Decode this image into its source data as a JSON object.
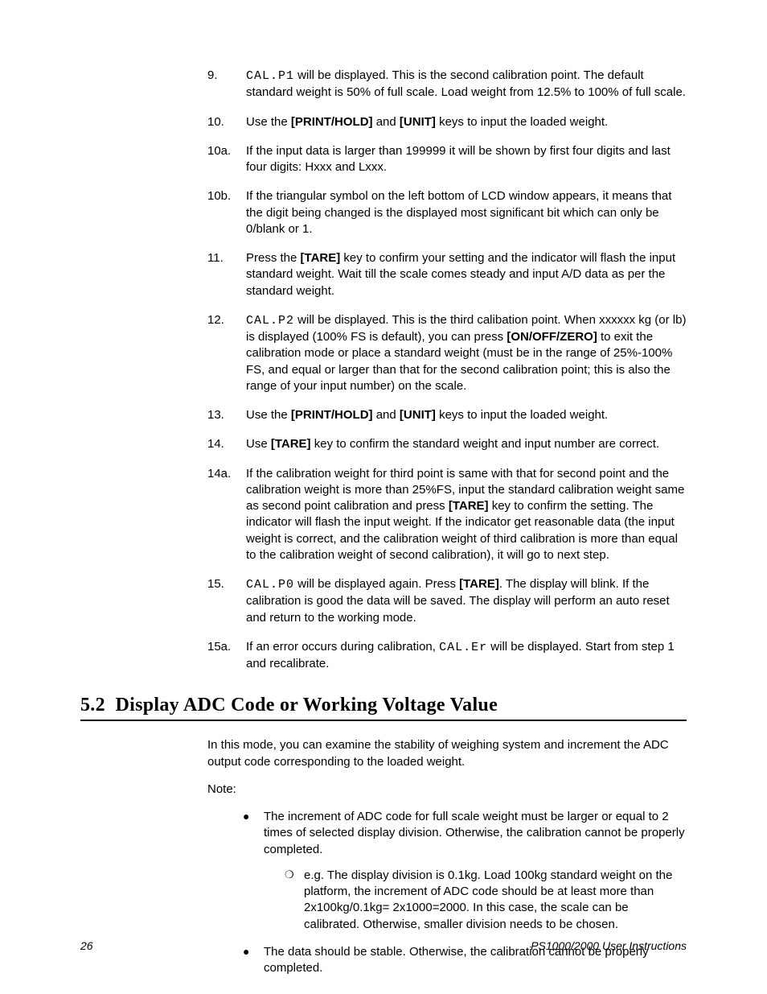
{
  "steps": [
    {
      "n": "9.",
      "lcd": "CAL.P1",
      "pre": "",
      "post": " will be displayed. This is the second calibration point. The default standard weight is 50% of full scale. Load weight from 12.5% to 100% of full scale."
    },
    {
      "n": "10.",
      "html": "Use the <b>[PRINT/HOLD]</b> and <b>[UNIT]</b> keys to input the loaded weight."
    },
    {
      "n": "10a.",
      "html": "If the input data is larger than 199999 it will be shown by first four digits and last four digits: Hxxx and Lxxx."
    },
    {
      "n": "10b.",
      "html": "If the triangular symbol on the left bottom of LCD window appears, it means that the digit being changed is the displayed most significant bit which can only be 0/blank or 1."
    },
    {
      "n": "11.",
      "html": "Press the <b>[TARE]</b> key to confirm your setting and the indicator will flash the input standard weight. Wait till the scale comes steady and input A/D data as per the standard weight."
    },
    {
      "n": "12.",
      "lcd": "CAL.P2",
      "post_html": " will be displayed. This is the third calibation point. When xxxxxx kg (or lb) is displayed (100% FS is default), you can press <b>[ON/OFF/ZERO]</b> to exit the calibration mode or place a standard weight (must be in the range of 25%-100% FS, and equal or larger than that for the second calibration point; this is also the range of your input number) on the scale."
    },
    {
      "n": "13.",
      "html": "Use the <b>[PRINT/HOLD]</b> and <b>[UNIT]</b> keys to input the loaded weight."
    },
    {
      "n": "14.",
      "html": "Use <b>[TARE]</b> key to confirm the standard weight and input number are correct."
    },
    {
      "n": "14a.",
      "html": " If the calibration weight for third point is same with that for second point and the calibration weight is more than 25%FS, input the standard calibration weight same as second point calibration and press <b>[TARE]</b> key to confirm the setting. The indicator will flash the input weight. If the indicator get reasonable data (the input weight is correct, and the calibration weight of third calibration is more than equal to the calibration weight of second calibration), it will go to next step."
    },
    {
      "n": "15.",
      "lcd": "CAL.P0",
      "post_html": " will be displayed again. Press <b>[TARE]</b>. The display will blink. If the calibration is good the data will be saved. The display will perform an auto reset and return to the working mode."
    },
    {
      "n": "15a.",
      "pre": "If an error occurs during calibration, ",
      "lcd": "CAL.Er",
      "post": " will be displayed. Start from step 1 and recalibrate."
    }
  ],
  "section": {
    "num": "5.2",
    "title": "Display ADC Code or Working Voltage Value"
  },
  "intro": "In this mode, you can examine the stability of weighing system and increment the ADC output code corresponding to the loaded weight.",
  "note_label": "Note:",
  "bullets": [
    {
      "text": "The increment of ADC code for full scale weight must be larger or equal to 2 times of selected display division. Otherwise, the calibration cannot be properly completed.",
      "sub": "e.g. The display division is 0.1kg. Load 100kg standard weight on the platform, the increment of ADC code should be at least more than 2x100kg/0.1kg= 2x1000=2000. In this case, the scale can be calibrated. Otherwise, smaller division needs to be chosen."
    },
    {
      "text": "The data should be stable. Otherwise, the calibration cannot be properly completed."
    }
  ],
  "footer": {
    "page": "26",
    "doc": "PS1000/2000 User Instructions"
  }
}
